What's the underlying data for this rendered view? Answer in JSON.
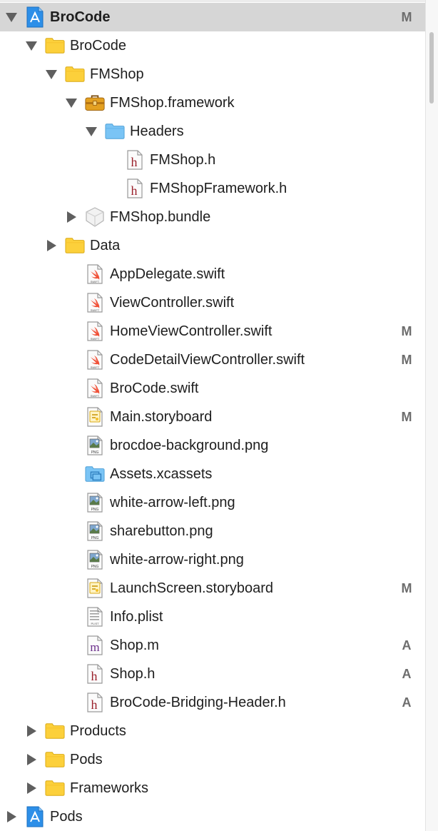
{
  "navigator": {
    "items": [
      {
        "label": "BroCode",
        "status": "M",
        "icon": "xcode-project-icon",
        "expanded": true
      },
      {
        "label": "BroCode",
        "status": "",
        "icon": "folder-icon",
        "expanded": true
      },
      {
        "label": "FMShop",
        "status": "",
        "icon": "folder-icon",
        "expanded": true
      },
      {
        "label": "FMShop.framework",
        "status": "",
        "icon": "framework-toolbox-icon",
        "expanded": true
      },
      {
        "label": "Headers",
        "status": "",
        "icon": "blue-folder-icon",
        "expanded": true
      },
      {
        "label": "FMShop.h",
        "status": "",
        "icon": "header-file-icon"
      },
      {
        "label": "FMShopFramework.h",
        "status": "",
        "icon": "header-file-icon"
      },
      {
        "label": "FMShop.bundle",
        "status": "",
        "icon": "bundle-icon",
        "expanded": false
      },
      {
        "label": "Data",
        "status": "",
        "icon": "folder-icon",
        "expanded": false
      },
      {
        "label": "AppDelegate.swift",
        "status": "",
        "icon": "swift-file-icon"
      },
      {
        "label": "ViewController.swift",
        "status": "",
        "icon": "swift-file-icon"
      },
      {
        "label": "HomeViewController.swift",
        "status": "M",
        "icon": "swift-file-icon"
      },
      {
        "label": "CodeDetailViewController.swift",
        "status": "M",
        "icon": "swift-file-icon"
      },
      {
        "label": "BroCode.swift",
        "status": "",
        "icon": "swift-file-icon"
      },
      {
        "label": "Main.storyboard",
        "status": "M",
        "icon": "storyboard-file-icon"
      },
      {
        "label": "brocdoe-background.png",
        "status": "",
        "icon": "png-file-icon"
      },
      {
        "label": "Assets.xcassets",
        "status": "",
        "icon": "asset-catalog-icon"
      },
      {
        "label": "white-arrow-left.png",
        "status": "",
        "icon": "png-file-icon"
      },
      {
        "label": "sharebutton.png",
        "status": "",
        "icon": "png-file-icon"
      },
      {
        "label": "white-arrow-right.png",
        "status": "",
        "icon": "png-file-icon"
      },
      {
        "label": "LaunchScreen.storyboard",
        "status": "M",
        "icon": "storyboard-file-icon"
      },
      {
        "label": "Info.plist",
        "status": "",
        "icon": "plist-file-icon"
      },
      {
        "label": "Shop.m",
        "status": "A",
        "icon": "objc-implementation-file-icon"
      },
      {
        "label": "Shop.h",
        "status": "A",
        "icon": "header-file-icon"
      },
      {
        "label": "BroCode-Bridging-Header.h",
        "status": "A",
        "icon": "header-file-icon"
      },
      {
        "label": "Products",
        "status": "",
        "icon": "folder-icon",
        "expanded": false
      },
      {
        "label": "Pods",
        "status": "",
        "icon": "folder-icon",
        "expanded": false
      },
      {
        "label": "Frameworks",
        "status": "",
        "icon": "folder-icon",
        "expanded": false
      },
      {
        "label": "Pods",
        "status": "",
        "icon": "xcode-project-icon",
        "expanded": false
      }
    ],
    "icon_glyphs": {
      "header": "h",
      "implementation": "m",
      "swift_badge": "SWIFT",
      "png_badge": "PNG",
      "plist_badge": "PLIST"
    }
  },
  "colors": {
    "selection": "#d6d6d6",
    "folder_yellow": "#fcd03b",
    "folder_blue": "#7ac4f5",
    "status_text": "#6d6d6d",
    "header_glyph": "#9a1f2a",
    "impl_glyph": "#6a2d8a",
    "swift_orange": "#f05138"
  }
}
